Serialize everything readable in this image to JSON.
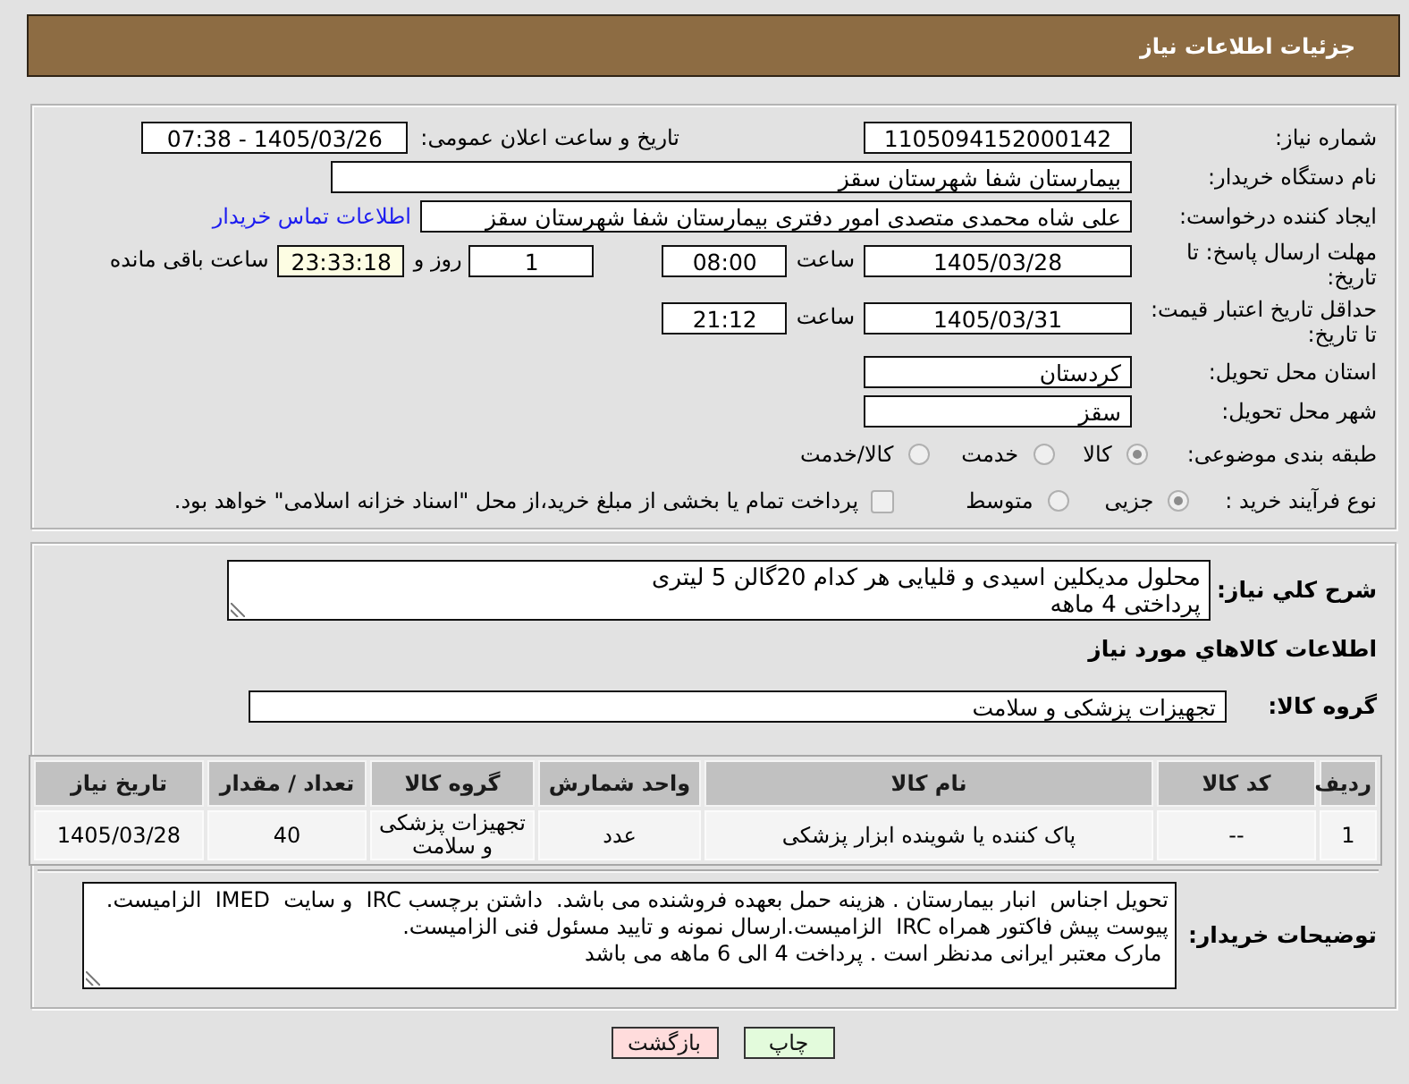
{
  "header": {
    "title": "جزئیات اطلاعات نیاز"
  },
  "details": {
    "need_number": {
      "label": "شماره نیاز:",
      "value": "1105094152000142"
    },
    "announcement": {
      "label": "تاریخ و ساعت اعلان عمومی:",
      "value": "1405/03/26 - 07:38"
    },
    "buyer_org": {
      "label": "نام دستگاه خریدار:",
      "value": "بیمارستان شفا شهرستان سقز"
    },
    "requester": {
      "label": "ایجاد کننده درخواست:",
      "value": "علی شاه محمدی متصدی امور دفتری بیمارستان شفا شهرستان سقز",
      "contact_link": "اطلاعات تماس خریدار"
    },
    "reply_deadline": {
      "label": "مهلت ارسال پاسخ: تا تاریخ:",
      "date": "1405/03/28",
      "time_label": "ساعت",
      "time": "08:00",
      "days": "1",
      "days_label": "روز و",
      "remaining": "23:33:18",
      "remaining_label": "ساعت باقی مانده"
    },
    "price_validity": {
      "label": "حداقل تاریخ اعتبار قیمت: تا تاریخ:",
      "date": "1405/03/31",
      "time_label": "ساعت",
      "time": "21:12"
    },
    "delivery_province": {
      "label": "استان محل تحویل:",
      "value": "کردستان"
    },
    "delivery_city": {
      "label": "شهر محل تحویل:",
      "value": "سقز"
    },
    "classification": {
      "label": "طبقه بندی موضوعی:",
      "disabled": true,
      "options": [
        {
          "label": "کالا",
          "selected": true
        },
        {
          "label": "خدمت",
          "selected": false
        },
        {
          "label": "کالا/خدمت",
          "selected": false
        }
      ]
    },
    "purchase_type": {
      "label": "نوع فرآیند خرید :",
      "disabled": true,
      "options": [
        {
          "label": "جزیی",
          "selected": true
        },
        {
          "label": "متوسط",
          "selected": false
        }
      ],
      "treasury_payment": {
        "label": "پرداخت تمام یا بخشی از مبلغ خرید،از محل \"اسناد خزانه اسلامی\" خواهد بود.",
        "checked": false,
        "disabled": true
      }
    }
  },
  "items": {
    "description": {
      "label": "شرح کلي نياز:",
      "value": "محلول مدیکلین اسیدی و قلیایی هر کدام 20گالن 5 لیتری\nپرداختی 4 ماهه"
    },
    "heading": "اطلاعات کالاهاي مورد نياز",
    "goods_group": {
      "label": "گروه کالا:",
      "value": "تجهیزات پزشکی و سلامت"
    },
    "table": {
      "columns": [
        "ردیف",
        "کد کالا",
        "نام کالا",
        "واحد شمارش",
        "گروه کالا",
        "تعداد / مقدار",
        "تاریخ نیاز"
      ],
      "rows": [
        [
          "1",
          "--",
          "پاک کننده یا شوینده ابزار پزشکی",
          "عدد",
          "تجهیزات پزشکی و سلامت",
          "40",
          "1405/03/28"
        ]
      ]
    },
    "buyer_notes": {
      "label": "توضیحات خریدار:",
      "value": "تحویل اجناس  انبار بیمارستان . هزینه حمل بعهده فروشنده می باشد.  داشتن برچسب IRC  و سایت  IMED  الزامیست.\nپیوست پیش فاکتور همراه IRC  الزامیست.ارسال نمونه و تایید مسئول فنی الزامیست.\n مارک معتبر ایرانی مدنظر است . پرداخت 4 الی 6 ماهه می باشد"
    }
  },
  "buttons": [
    {
      "label": "چاپ",
      "kind": "print"
    },
    {
      "label": "بازگشت",
      "kind": "back"
    }
  ]
}
